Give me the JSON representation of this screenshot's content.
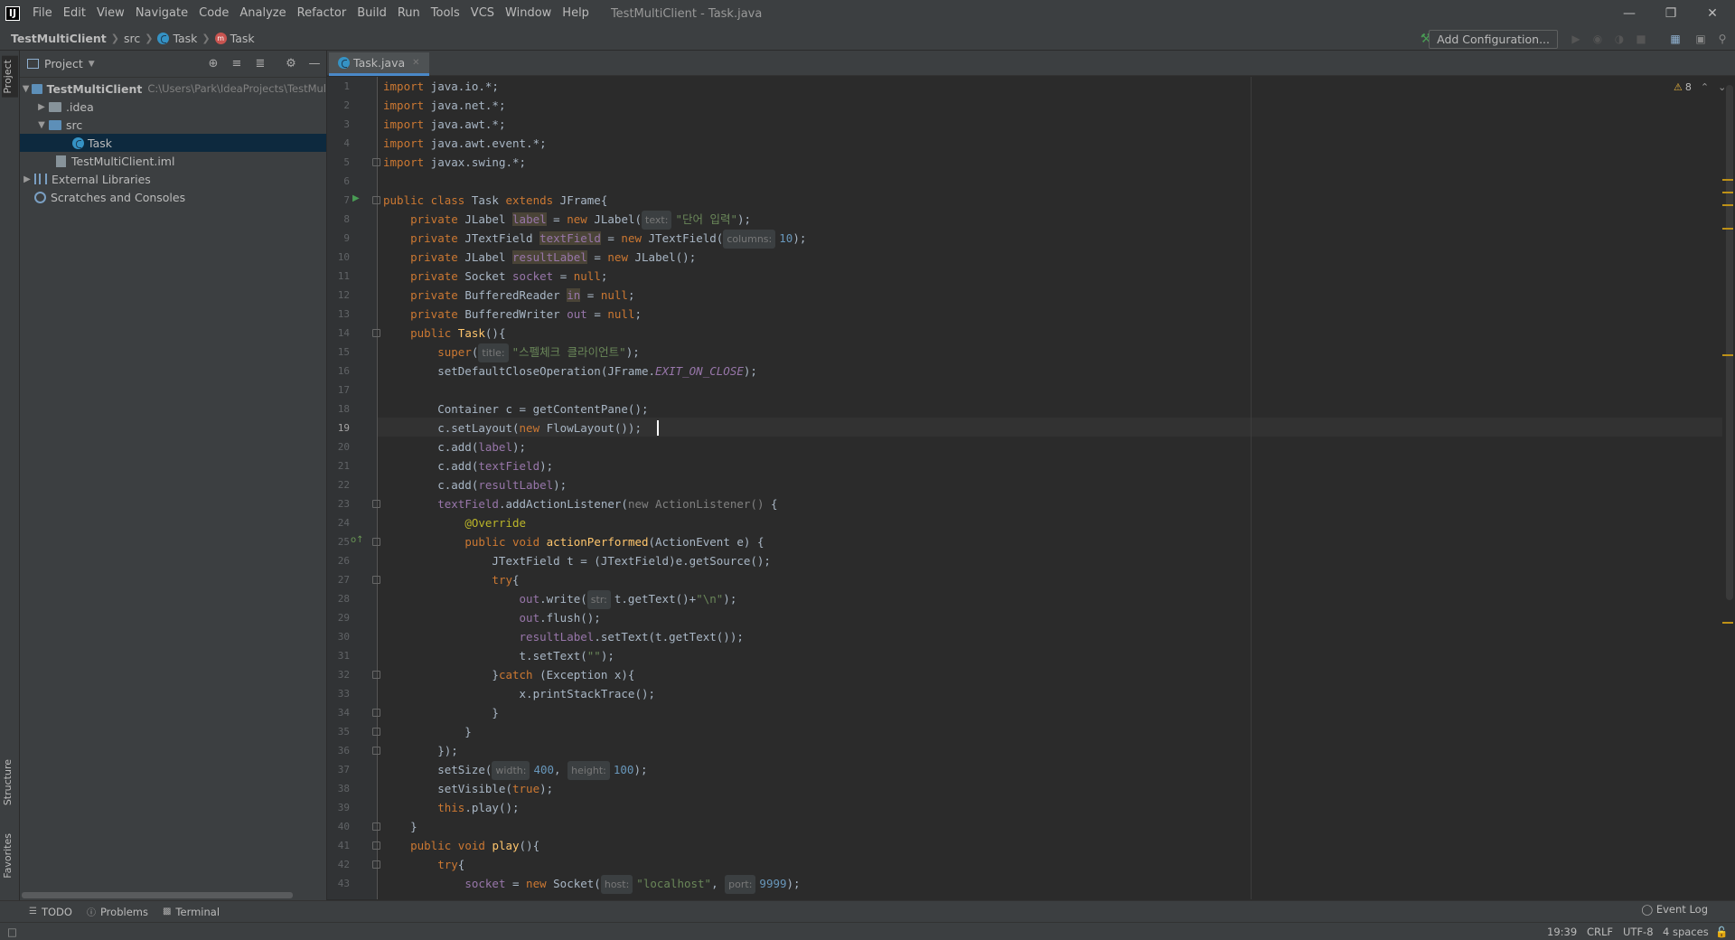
{
  "menu": [
    "File",
    "Edit",
    "View",
    "Navigate",
    "Code",
    "Analyze",
    "Refactor",
    "Build",
    "Run",
    "Tools",
    "VCS",
    "Window",
    "Help"
  ],
  "window_title": "TestMultiClient - Task.java",
  "breadcrumb": {
    "project": "TestMultiClient",
    "folder": "src",
    "class": "Task",
    "member": "Task"
  },
  "toolbar": {
    "add_config": "Add Configuration..."
  },
  "project_panel": {
    "title": "Project",
    "root": "TestMultiClient",
    "root_path": "C:\\Users\\Park\\IdeaProjects\\TestMul",
    "idea": ".idea",
    "src": "src",
    "task": "Task",
    "iml": "TestMultiClient.iml",
    "ext": "External Libraries",
    "scratches": "Scratches and Consoles"
  },
  "side_tabs": {
    "project": "Project",
    "structure": "Structure",
    "favorites": "Favorites"
  },
  "editor_tab": "Task.java",
  "code_lines": [
    "1",
    "2",
    "3",
    "4",
    "5",
    "6",
    "7",
    "8",
    "9",
    "10",
    "11",
    "12",
    "13",
    "14",
    "15",
    "16",
    "17",
    "18",
    "19",
    "20",
    "21",
    "22",
    "23",
    "24",
    "25",
    "26",
    "27",
    "28",
    "29",
    "30",
    "31",
    "32",
    "33",
    "34",
    "35",
    "36",
    "37",
    "38",
    "39",
    "40",
    "41",
    "42",
    "43"
  ],
  "warnings": "8",
  "bottom_tabs": {
    "todo": "TODO",
    "problems": "Problems",
    "terminal": "Terminal",
    "event_log": "Event Log"
  },
  "status": {
    "position": "19:39",
    "line_sep": "CRLF",
    "encoding": "UTF-8",
    "indent": "4 spaces"
  },
  "colors": {
    "keyword": "#cc7832",
    "field": "#9876aa",
    "string": "#6a8759",
    "number": "#6897bb",
    "method": "#ffc66d",
    "annotation": "#bbb529"
  }
}
